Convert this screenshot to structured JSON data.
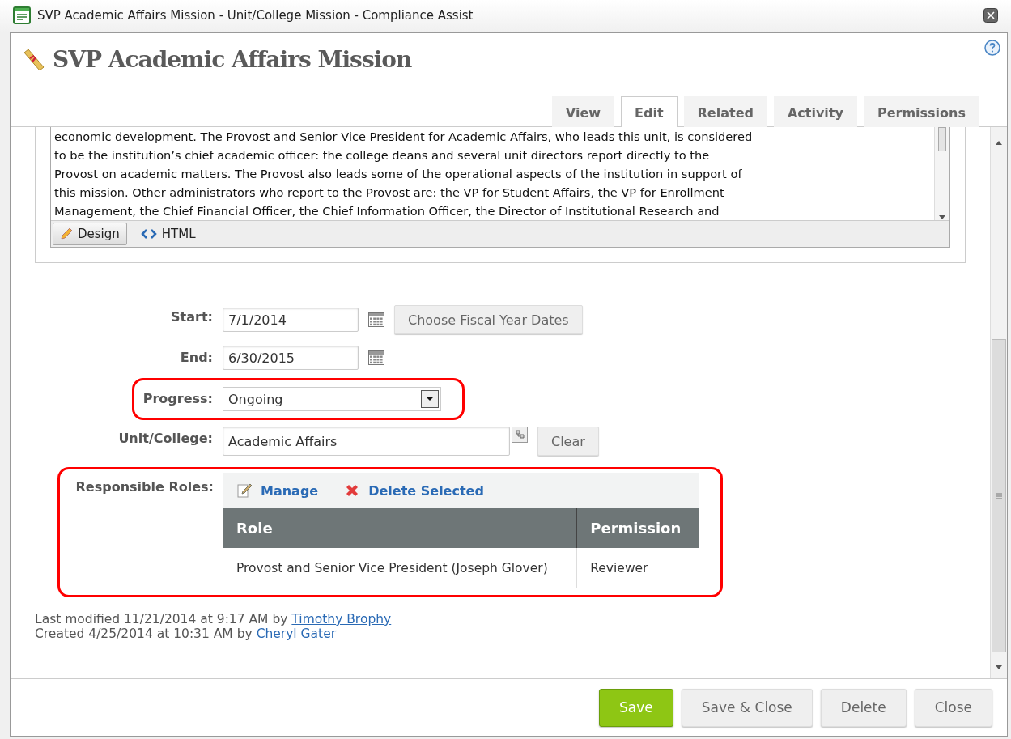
{
  "window": {
    "title": "SVP Academic Affairs Mission - Unit/College Mission - Compliance Assist"
  },
  "page": {
    "title": "SVP Academic Affairs Mission"
  },
  "tabs": [
    {
      "label": "View",
      "selected": false
    },
    {
      "label": "Edit",
      "selected": true
    },
    {
      "label": "Related",
      "selected": false
    },
    {
      "label": "Activity",
      "selected": false
    },
    {
      "label": "Permissions",
      "selected": false
    }
  ],
  "editor": {
    "lines": [
      "economic development. The Provost and Senior Vice President for Academic Affairs, who leads this unit, is considered",
      "to be the institution’s chief academic officer: the college deans and several unit directors report directly to the",
      "Provost on academic matters. The Provost also leads some of the operational aspects of the institution in support of",
      "this mission. Other administrators who report to the Provost are: the VP for Student Affairs, the VP for Enrollment",
      "Management, the Chief Financial Officer, the Chief Information Officer, the Director of Institutional Research and"
    ],
    "modes": [
      {
        "label": "Design",
        "kind": "design",
        "selected": true
      },
      {
        "label": "HTML",
        "kind": "html",
        "selected": false
      }
    ]
  },
  "form": {
    "start": {
      "label": "Start:",
      "value": "7/1/2014"
    },
    "fiscal_button": "Choose Fiscal Year Dates",
    "end": {
      "label": "End:",
      "value": "6/30/2015"
    },
    "progress": {
      "label": "Progress:",
      "value": "Ongoing",
      "highlighted": true
    },
    "unit": {
      "label": "Unit/College:",
      "value": "Academic Affairs"
    },
    "clear_button": "Clear"
  },
  "roles": {
    "label": "Responsible Roles:",
    "highlighted": true,
    "actions": [
      {
        "label": "Manage",
        "kind": "manage"
      },
      {
        "label": "Delete Selected",
        "kind": "delete"
      }
    ],
    "columns": [
      "Role",
      "Permission"
    ],
    "rows": [
      [
        "Provost and Senior Vice President (Joseph Glover)",
        "Reviewer"
      ]
    ]
  },
  "audit": [
    {
      "text": "Last modified 11/21/2014 at 9:17 AM by",
      "user": "Timothy Brophy"
    },
    {
      "text": "Created 4/25/2014 at 10:31 AM by",
      "user": "Cheryl Gater"
    }
  ],
  "buttons": [
    {
      "label": "Save",
      "kind": "primary"
    },
    {
      "label": "Save & Close",
      "kind": "secondary"
    },
    {
      "label": "Delete",
      "kind": "secondary"
    },
    {
      "label": "Close",
      "kind": "secondary"
    }
  ]
}
